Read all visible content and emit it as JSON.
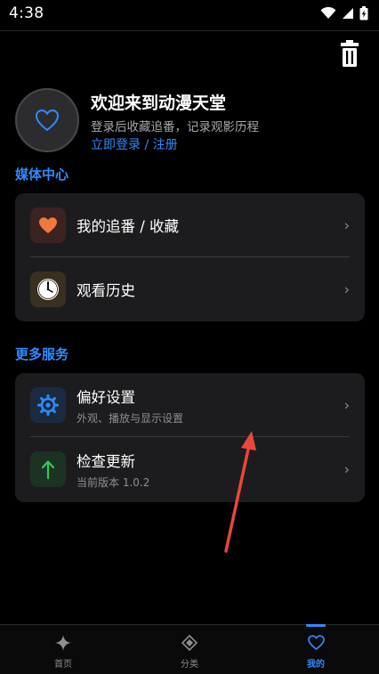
{
  "status_bar": {
    "time": "4:38"
  },
  "profile": {
    "title": "欢迎来到动漫天堂",
    "subtitle": "登录后收藏追番，记录观影历程",
    "login_link": "立即登录 / 注册"
  },
  "media_center": {
    "title": "媒体中心",
    "items": [
      {
        "label": "我的追番 / 收藏",
        "icon": "heart-icon"
      },
      {
        "label": "观看历史",
        "icon": "clock-icon"
      }
    ]
  },
  "more_services": {
    "title": "更多服务",
    "items": [
      {
        "label": "偏好设置",
        "sub": "外观、播放与显示设置",
        "icon": "gear-icon"
      },
      {
        "label": "检查更新",
        "sub": "当前版本 1.0.2",
        "icon": "arrow-up-icon"
      }
    ]
  },
  "bottom_nav": {
    "items": [
      {
        "label": "首页",
        "icon": "sparkle-icon"
      },
      {
        "label": "分类",
        "icon": "diamond-icon"
      },
      {
        "label": "我的",
        "icon": "heart-outline-icon",
        "active": true
      }
    ]
  },
  "colors": {
    "accent": "#2f8bff",
    "background": "#000000",
    "card": "#1c1c1e",
    "annotation": "#e8473b"
  }
}
